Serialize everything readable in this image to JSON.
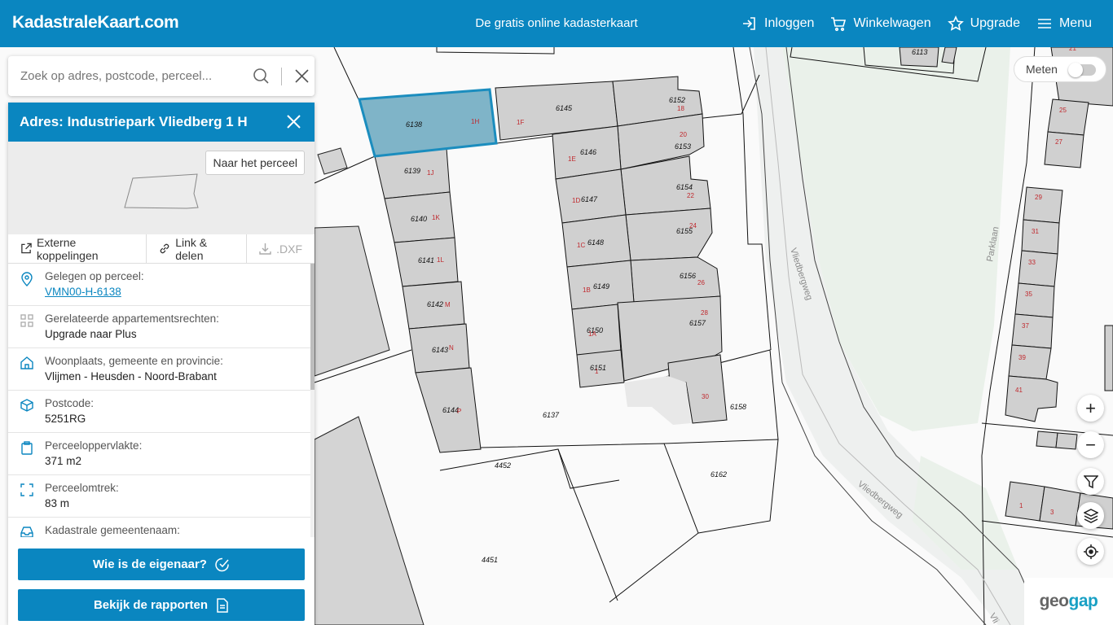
{
  "header": {
    "logo": "KadastraleKaart.com",
    "tagline": "De gratis online kadasterkaart",
    "nav": {
      "login": "Inloggen",
      "cart": "Winkelwagen",
      "upgrade": "Upgrade",
      "menu": "Menu"
    }
  },
  "search": {
    "placeholder": "Zoek op adres, postcode, perceel..."
  },
  "panel": {
    "title": "Adres: Industriepark Vliedberg 1 H",
    "goto_label": "Naar het perceel",
    "actions": {
      "external": "Externe koppelingen",
      "share": "Link & delen",
      "dxf": ".DXF"
    },
    "rows": [
      {
        "label": "Gelegen op perceel:",
        "value": "VMN00-H-6138"
      },
      {
        "label": "Gerelateerde appartementsrechten:",
        "value": "Upgrade naar Plus"
      },
      {
        "label": "Woonplaats, gemeente en provincie:",
        "value": "Vlijmen - Heusden - Noord-Brabant"
      },
      {
        "label": "Postcode:",
        "value": "5251RG"
      },
      {
        "label": "Perceeloppervlakte:",
        "value": "371 m2"
      },
      {
        "label": "Perceelomtrek:",
        "value": "83 m"
      },
      {
        "label": "Kadastrale gemeentenaam:",
        "value": ""
      }
    ],
    "btn_owner": "Wie is de eigenaar?",
    "btn_reports": "Bekijk de rapporten"
  },
  "map_controls": {
    "meten": "Meten",
    "zoom_in": "+",
    "zoom_out": "−"
  },
  "brand": {
    "geo": "geo",
    "gap": "gap"
  },
  "map_labels": {
    "parcels": [
      "6138",
      "6145",
      "6152",
      "6146",
      "6153",
      "6139",
      "6154",
      "6147",
      "6140",
      "6155",
      "6148",
      "6141",
      "6156",
      "6149",
      "6142",
      "6157",
      "6150",
      "6143",
      "6151",
      "6158",
      "6144",
      "6137",
      "4452",
      "6162",
      "4451",
      "6113"
    ],
    "house_numbers": [
      "1H",
      "1F",
      "18",
      "20",
      "1E",
      "1J",
      "22",
      "1D",
      "24",
      "1K",
      "1C",
      "1L",
      "26",
      "1B",
      "M",
      "28",
      "1A",
      "N",
      "1",
      "30",
      "P",
      "21",
      "25",
      "27",
      "29",
      "31",
      "33",
      "35",
      "37",
      "39",
      "41",
      "1",
      "3"
    ],
    "streets": [
      "Vliedbergweg",
      "Vliedbergweg",
      "Parklaan",
      "Vli"
    ]
  },
  "colors": {
    "brand": "#0a86c0",
    "selected_parcel": "#7fb4c8",
    "building": "#d0d0d0"
  }
}
